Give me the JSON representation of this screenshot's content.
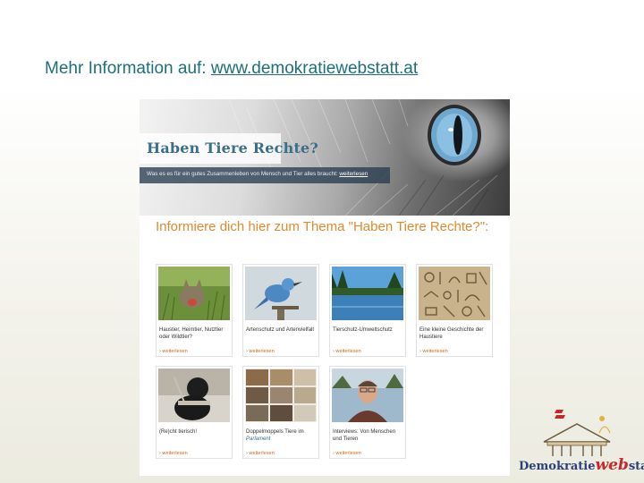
{
  "headline": {
    "prefix": "Mehr Information auf: ",
    "url": "www.demokratiewebstatt.at"
  },
  "screenshot": {
    "title": "Haben Tiere Rechte?",
    "bar_text": "Was es es für ein gutes Zusammenleben von Mensch und Tier alles braucht:",
    "bar_link": "weiterlesen",
    "intro": "Informiere dich hier zum Thema \"Haben Tiere Rechte?\":",
    "tiles": [
      {
        "caption": "Haustier, Heimtier, Nutztier oder Wildtier?",
        "more": "› weiterlesen",
        "image": "cat-in-grass"
      },
      {
        "caption": "Artenschutz und Artenvielfalt",
        "more": "› weiterlesen",
        "image": "blue-bird"
      },
      {
        "caption": "Tierschutz-Umweltschutz",
        "more": "› weiterlesen",
        "image": "lake-landscape"
      },
      {
        "caption": "Eine kleine Geschichte der Haustiere",
        "more": "› weiterlesen",
        "image": "hieroglyphs"
      },
      {
        "caption": "(Re)cht tierisch!",
        "more": "› weiterlesen",
        "image": "guide-dog"
      },
      {
        "caption": "Doppelmoppels Tiere im",
        "caption_italic": "Parlament",
        "more": "› weiterlesen",
        "image": "parliament-statues"
      },
      {
        "caption": "Interviews: Von Menschen und Tieren",
        "more": "› weiterlesen",
        "image": "man-portrait"
      }
    ]
  },
  "logo": {
    "part1": "Demokratie",
    "part2": "web",
    "part3": "statt"
  },
  "colors": {
    "headline": "#1f6f7a",
    "accent": "#e08a2e",
    "title": "#3a6f8a"
  }
}
